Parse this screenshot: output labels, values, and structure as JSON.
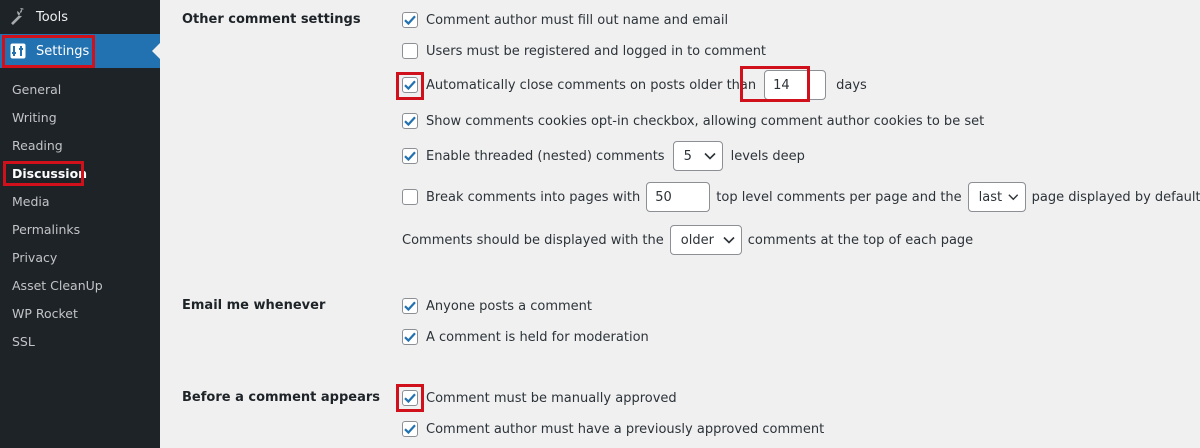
{
  "sidebar": {
    "tools_label": "Tools",
    "settings_label": "Settings",
    "submenu": [
      {
        "label": "General"
      },
      {
        "label": "Writing"
      },
      {
        "label": "Reading"
      },
      {
        "label": "Discussion"
      },
      {
        "label": "Media"
      },
      {
        "label": "Permalinks"
      },
      {
        "label": "Privacy"
      },
      {
        "label": "Asset CleanUp"
      },
      {
        "label": "WP Rocket"
      },
      {
        "label": "SSL"
      }
    ],
    "current": "Discussion"
  },
  "sections": {
    "other": {
      "label": "Other comment settings",
      "require_name_email": {
        "label": "Comment author must fill out name and email",
        "checked": true
      },
      "registration": {
        "label": "Users must be registered and logged in to comment",
        "checked": false
      },
      "close_comments": {
        "label_before": "Automatically close comments on posts older than",
        "days_value": "14",
        "label_after": "days",
        "checked": true
      },
      "cookies": {
        "label": "Show comments cookies opt-in checkbox, allowing comment author cookies to be set",
        "checked": true
      },
      "threaded": {
        "label_before": "Enable threaded (nested) comments",
        "depth_value": "5",
        "label_after": "levels deep",
        "checked": true
      },
      "paged": {
        "label_before": "Break comments into pages with",
        "per_page_value": "50",
        "label_middle": "top level comments per page and the",
        "page_value": "last",
        "label_after": "page displayed by default",
        "checked": false
      },
      "order": {
        "label_before": "Comments should be displayed with the",
        "order_value": "older",
        "label_after": "comments at the top of each page"
      }
    },
    "email": {
      "label": "Email me whenever",
      "anyone_posts": {
        "label": "Anyone posts a comment",
        "checked": true
      },
      "moderation": {
        "label": "A comment is held for moderation",
        "checked": true
      }
    },
    "before": {
      "label": "Before a comment appears",
      "manual": {
        "label": "Comment must be manually approved",
        "checked": true
      },
      "previous": {
        "label": "Comment author must have a previously approved comment",
        "checked": true
      }
    }
  },
  "colors": {
    "sidebar_bg": "#1d2327",
    "accent": "#2271b1",
    "highlight_border": "#d0111b",
    "page_bg": "#f0f0f1"
  }
}
